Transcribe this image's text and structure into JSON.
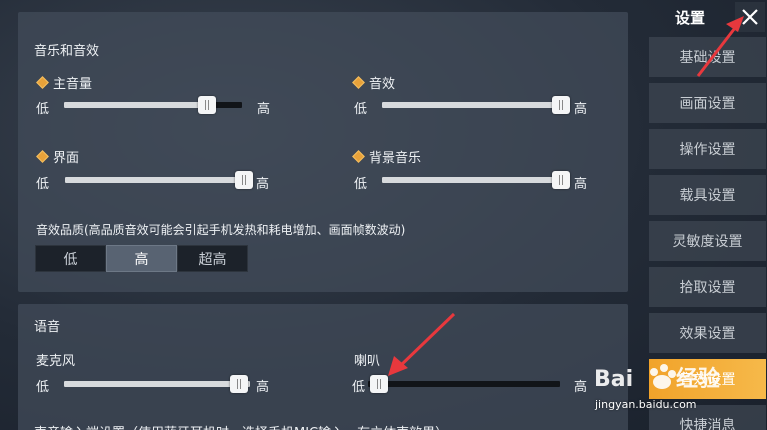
{
  "music_section": {
    "title": "音乐和音效",
    "sliders": [
      {
        "label": "主音量",
        "low": "低",
        "high": "高",
        "value": 0.8
      },
      {
        "label": "音效",
        "low": "低",
        "high": "高",
        "value": 1.0
      },
      {
        "label": "界面",
        "low": "低",
        "high": "高",
        "value": 1.0
      },
      {
        "label": "背景音乐",
        "low": "低",
        "high": "高",
        "value": 1.0
      }
    ],
    "quality_label": "音效品质(高品质音效可能会引起手机发热和耗电增加、画面帧数波动)",
    "quality_options": [
      "低",
      "高",
      "超高"
    ],
    "quality_selected": "高"
  },
  "voice_section": {
    "title": "语音",
    "sliders": [
      {
        "label": "麦克风",
        "low": "低",
        "high": "高",
        "value": 1.0
      },
      {
        "label": "喇叭",
        "low": "低",
        "high": "高",
        "value": 0.0
      }
    ],
    "next_line": "声音输入端设置（使用蓝牙耳机时，选择手机MIC输入，有立体声效果）"
  },
  "nav": {
    "title": "设置",
    "close_glyph": "✕",
    "items": [
      {
        "label": "基础设置",
        "active": false
      },
      {
        "label": "画面设置",
        "active": false
      },
      {
        "label": "操作设置",
        "active": false
      },
      {
        "label": "载具设置",
        "active": false
      },
      {
        "label": "灵敏度设置",
        "active": false
      },
      {
        "label": "拾取设置",
        "active": false
      },
      {
        "label": "效果设置",
        "active": false
      },
      {
        "label": "音效设置",
        "active": true
      },
      {
        "label": "快捷消息",
        "active": false
      }
    ]
  },
  "watermark": {
    "logo": "Baidu经验",
    "url": "jingyan.baidu.com"
  },
  "colors": {
    "accent": "#f1a32a",
    "arrow": "#e8383d",
    "diamond": "#e8a23a"
  }
}
